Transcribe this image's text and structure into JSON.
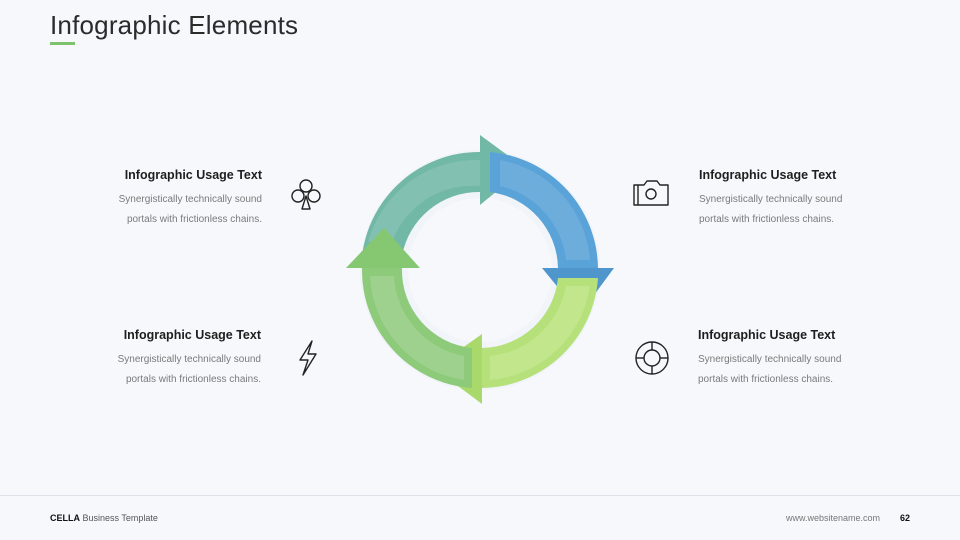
{
  "slide": {
    "title": "Infographic Elements",
    "accent_color": "#7dc36b"
  },
  "blocks": [
    {
      "heading": "Infographic Usage Text",
      "line1": "Synergistically technically sound",
      "line2": "portals with frictionless chains.",
      "icon": "club-icon"
    },
    {
      "heading": "Infographic Usage Text",
      "line1": "Synergistically technically sound",
      "line2": "portals with frictionless  chains.",
      "icon": "camera-icon"
    },
    {
      "heading": "Infographic Usage Text",
      "line1": "Synergistically technically sound",
      "line2": "portals with frictionless chains.",
      "icon": "lightning-icon"
    },
    {
      "heading": "Infographic Usage Text",
      "line1": "Synergistically technically sound",
      "line2": "portals with frictionless chains.",
      "icon": "lifebuoy-icon"
    }
  ],
  "cycle": {
    "arrow_colors": [
      "#6ab5a0",
      "#5aa0d6",
      "#b8e37a",
      "#8fcb7a"
    ]
  },
  "footer": {
    "brand": "CELLA",
    "brand_suffix": " Business Template",
    "website": "www.websitename.com",
    "page_number": "62"
  }
}
